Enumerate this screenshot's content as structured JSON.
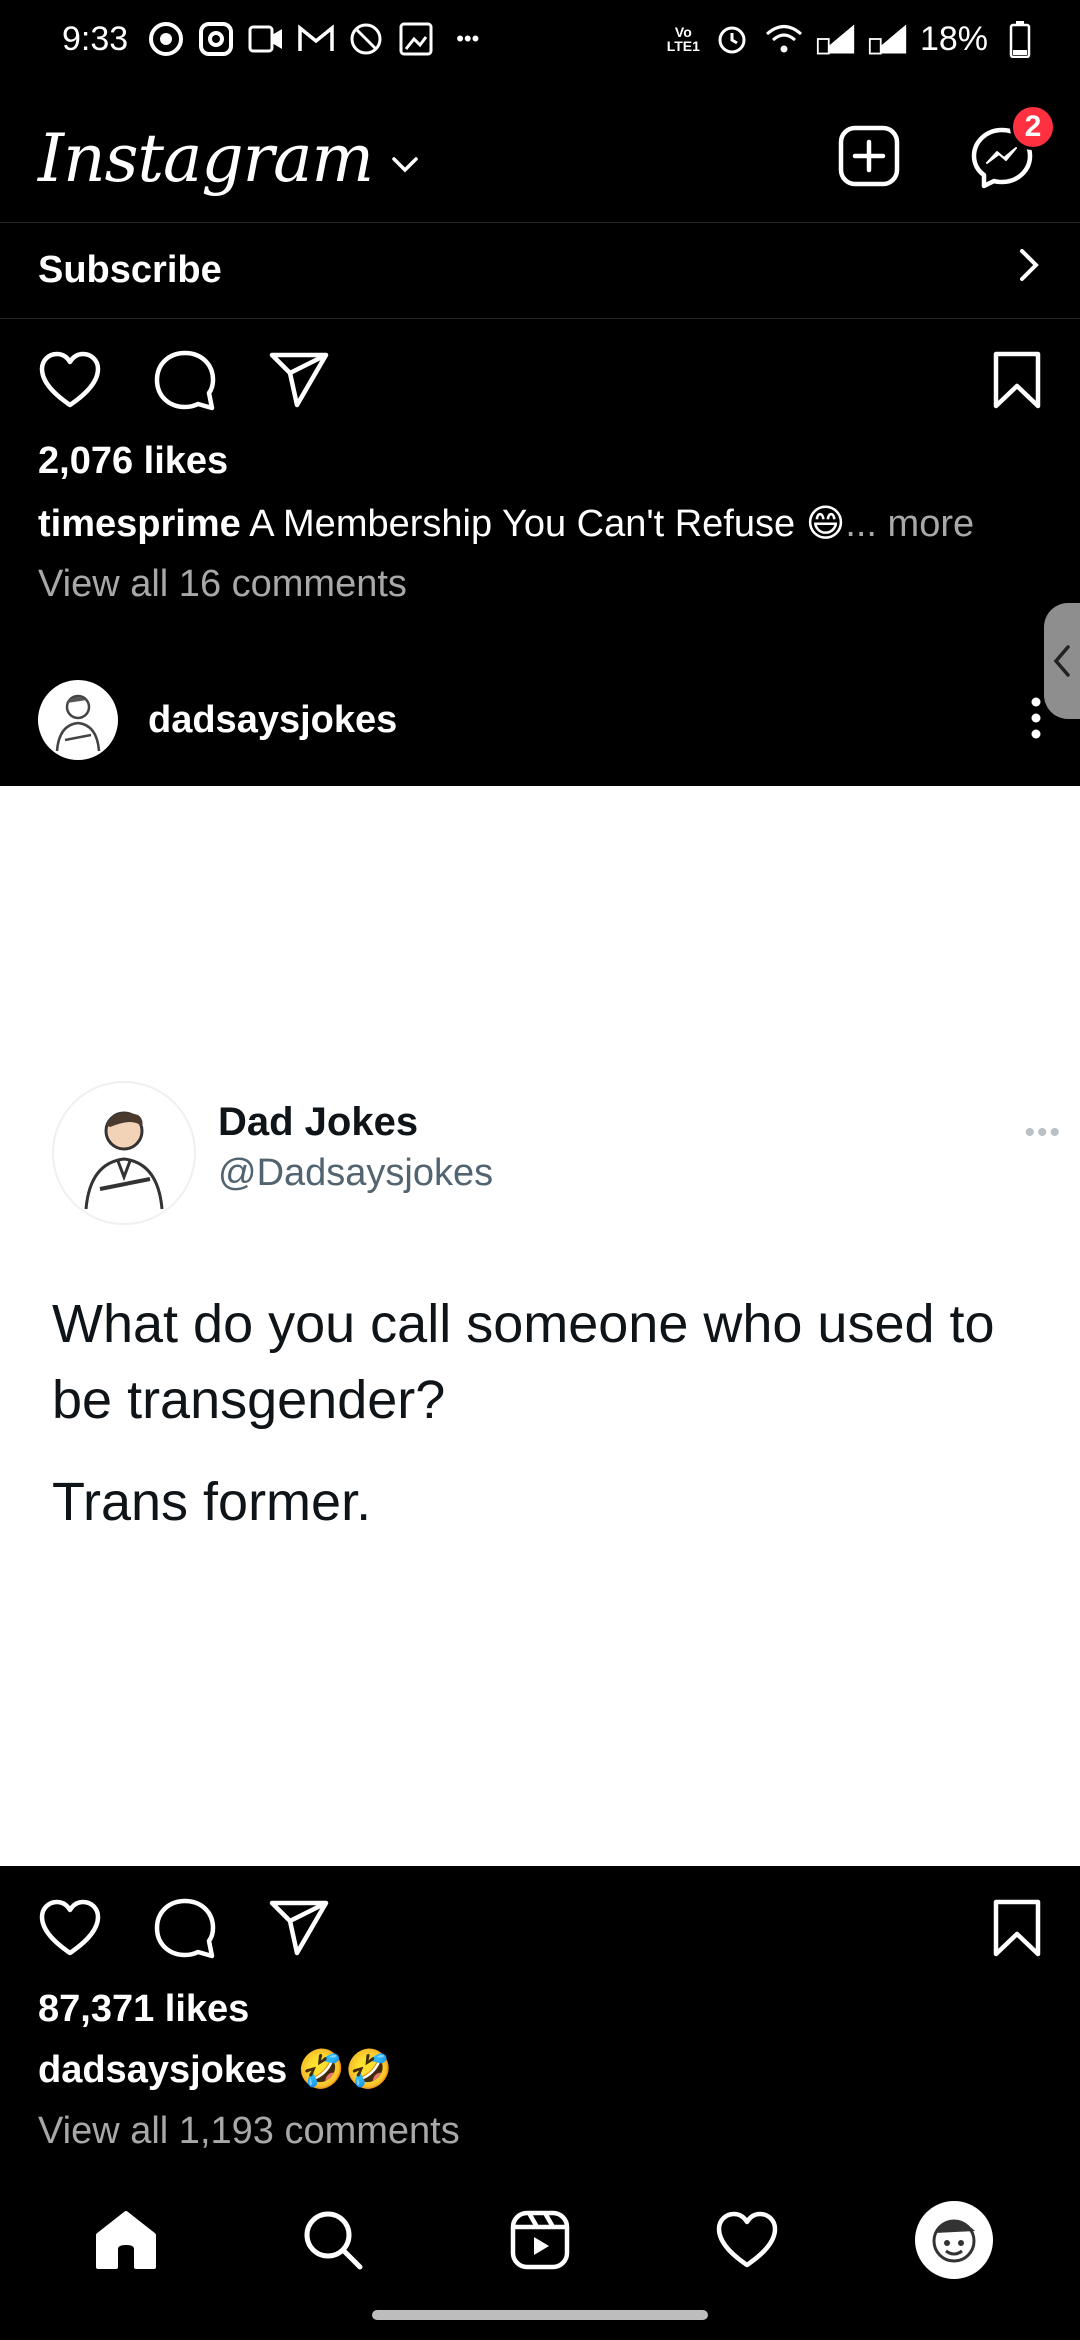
{
  "status_bar": {
    "time": "9:33",
    "volte_label": "Vo\nLTE1",
    "battery": "18%"
  },
  "header": {
    "logo": "Instagram",
    "notification_count": "2"
  },
  "subscribe": {
    "label": "Subscribe"
  },
  "post1": {
    "likes": "2,076 likes",
    "caption_user": "timesprime",
    "caption_text": "A Membership You Can't Refuse 😄",
    "caption_more": "... more",
    "view_comments": "View all 16 comments"
  },
  "post2": {
    "username": "dadsaysjokes",
    "tweet": {
      "name": "Dad Jokes",
      "handle": "@Dadsaysjokes",
      "more": "•••",
      "line1": "What do you call someone who used to be transgender?",
      "line2": "Trans former."
    },
    "likes": "87,371 likes",
    "caption_user": "dadsaysjokes",
    "caption_text": "🤣🤣",
    "view_comments": "View all 1,193 comments"
  },
  "colors": {
    "background": "#000000",
    "badge": "#ff3040",
    "secondary_text": "#a8a8a8",
    "tweet_handle": "#536471"
  }
}
